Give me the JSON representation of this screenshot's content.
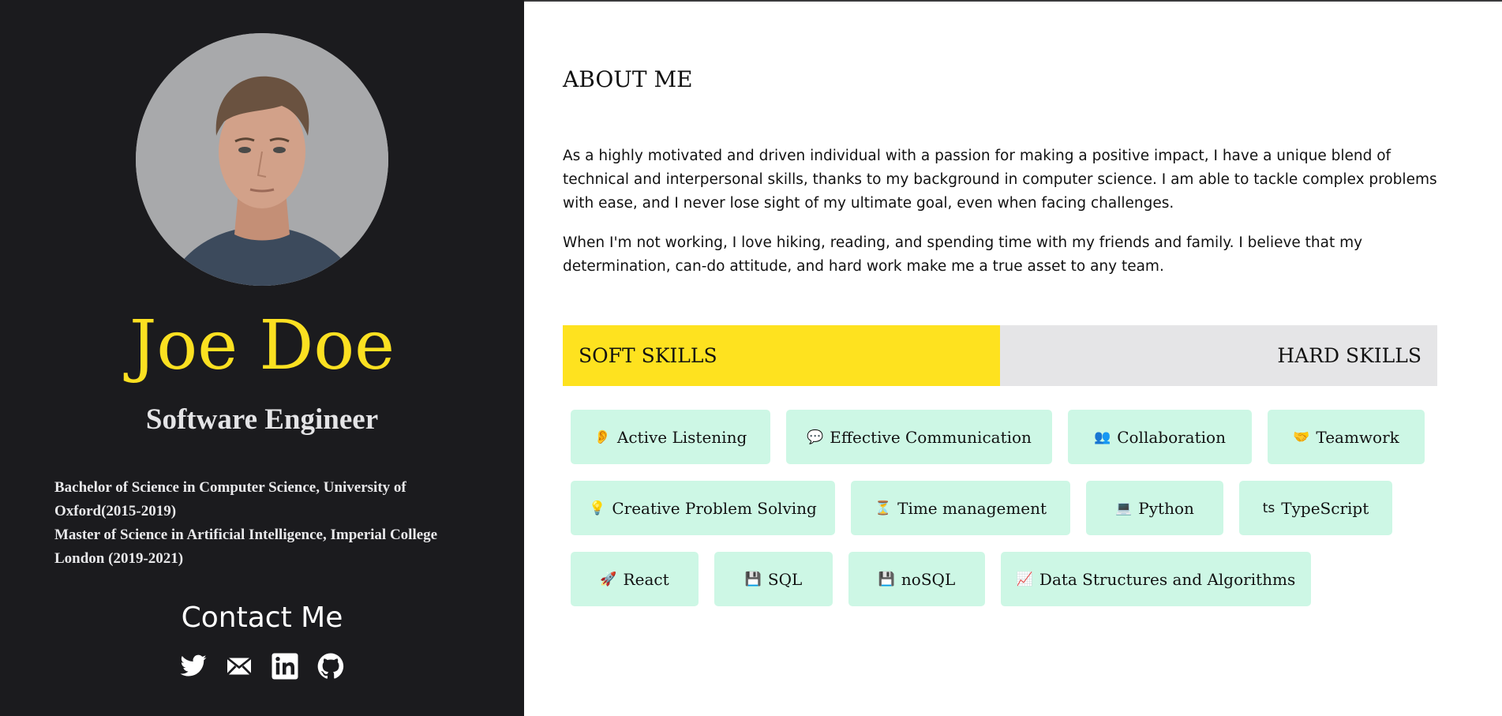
{
  "profile": {
    "name": "Joe Doe",
    "role": "Software Engineer",
    "education": [
      "Bachelor of Science in Computer Science, University of Oxford(2015-2019)",
      "Master of Science in Artificial Intelligence, Imperial College London (2019-2021)"
    ],
    "contact_title": "Contact Me",
    "social": [
      {
        "icon": "twitter-icon"
      },
      {
        "icon": "mail-icon"
      },
      {
        "icon": "linkedin-icon"
      },
      {
        "icon": "github-icon"
      }
    ]
  },
  "about": {
    "title": "ABOUT ME",
    "paragraphs": [
      "As a highly motivated and driven individual with a passion for making a positive impact, I have a unique blend of technical and interpersonal skills, thanks to my background in computer science. I am able to tackle complex problems with ease, and I never lose sight of my ultimate goal, even when facing challenges.",
      "When I'm not working, I love hiking, reading, and spending time with my friends and family. I believe that my determination, can-do attitude, and hard work make me a true asset to any team."
    ]
  },
  "tabs": {
    "soft": "SOFT SKILLS",
    "hard": "HARD SKILLS",
    "active": "soft"
  },
  "skills": [
    {
      "icon": "👂",
      "label": "Active Listening"
    },
    {
      "icon": "💬",
      "label": "Effective Communication"
    },
    {
      "icon": "👥",
      "label": "Collaboration"
    },
    {
      "icon": "🤝",
      "label": "Teamwork"
    },
    {
      "icon": "💡",
      "label": "Creative Problem Solving"
    },
    {
      "icon": "⏳",
      "label": "Time management"
    },
    {
      "icon": "💻",
      "label": "Python"
    },
    {
      "icon": "ts",
      "label": "TypeScript"
    },
    {
      "icon": "🚀",
      "label": "React"
    },
    {
      "icon": "💾",
      "label": "SQL"
    },
    {
      "icon": "💾",
      "label": "noSQL"
    },
    {
      "icon": "📈",
      "label": "Data Structures and Algorithms"
    }
  ],
  "colors": {
    "sidebar_bg": "#1b1b1e",
    "name": "#fbe021",
    "soft_tab": "#fee21f",
    "hard_tab": "#e5e5e7",
    "chip_bg": "#cdf7e5"
  }
}
